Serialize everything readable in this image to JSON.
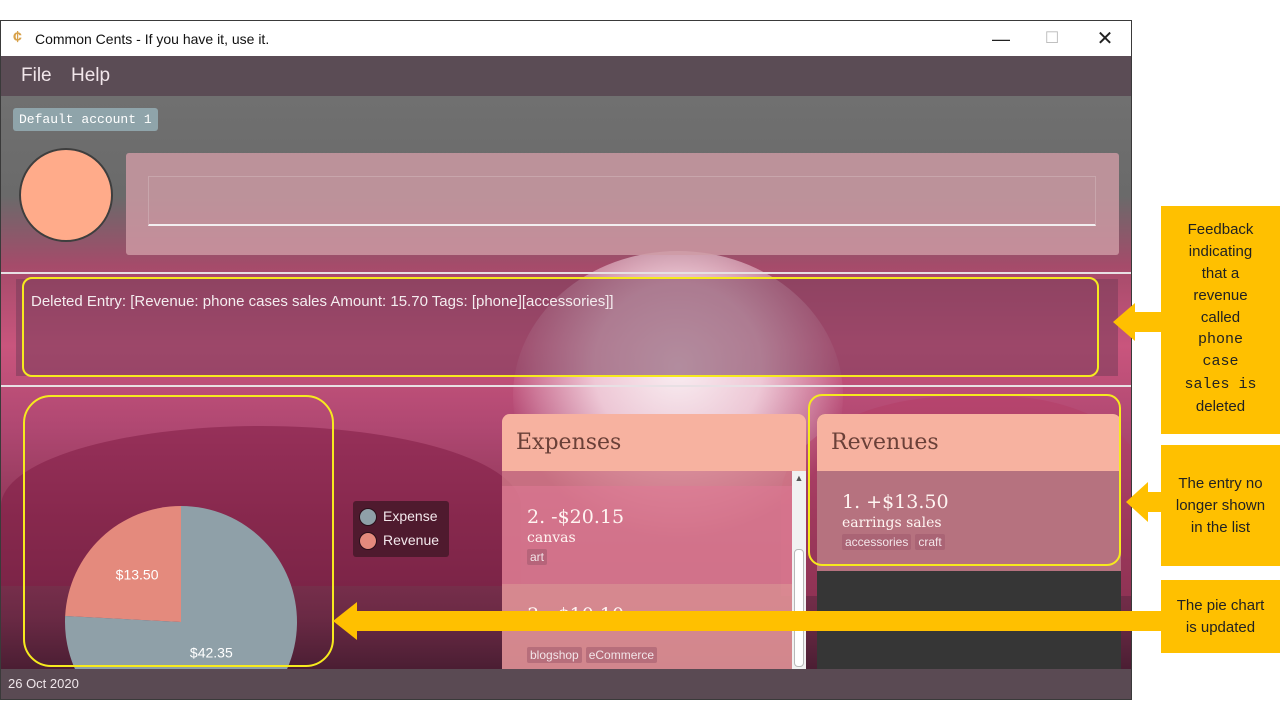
{
  "window": {
    "title": "Common Cents - If you have it, use it.",
    "app_icon": "cents-logo-icon",
    "controls": {
      "minimize": "—",
      "maximize": "☐",
      "close": "✕"
    }
  },
  "menu": {
    "items": [
      "File",
      "Help"
    ]
  },
  "account": {
    "name": "Default account 1"
  },
  "command_box": {
    "value": ""
  },
  "result": {
    "text": "Deleted Entry: [Revenue: phone cases sales Amount: 15.70 Tags: [phone][accessories]]"
  },
  "chart_data": {
    "type": "pie",
    "slices": [
      {
        "label": "Expense",
        "value": 42.35,
        "value_label": "$42.35",
        "color": "#8fa0a8"
      },
      {
        "label": "Revenue",
        "value": 13.5,
        "value_label": "$13.50",
        "color": "#e48a7d"
      }
    ],
    "legend": [
      "Expense",
      "Revenue"
    ],
    "legend_position": "right"
  },
  "expenses": {
    "title": "Expenses",
    "entries": [
      {
        "title": "2.  -$20.15",
        "description": "canvas",
        "tags": [
          "art"
        ]
      },
      {
        "title": "3.  -$10.10",
        "description": "",
        "tags": [
          "blogshop",
          "eCommerce"
        ]
      }
    ]
  },
  "revenues": {
    "title": "Revenues",
    "entries": [
      {
        "title": "1.  +$13.50",
        "description": "earrings sales",
        "tags": [
          "accessories",
          "craft"
        ]
      }
    ]
  },
  "status": {
    "date": "26 Oct 2020"
  },
  "callouts": {
    "feedback": [
      "Feedback",
      "indicating",
      "that a",
      "revenue",
      "called",
      "phone",
      "case",
      "sales is",
      "deleted"
    ],
    "entry": [
      "The entry no",
      "longer shown",
      "in the list"
    ],
    "pie": [
      "The pie chart",
      "is updated"
    ]
  },
  "colors": {
    "annotation_outline": "#f6ea1e",
    "callout": "#ffc000",
    "avatar": "#ffab8a",
    "panel_header": "#f7b2a0"
  }
}
